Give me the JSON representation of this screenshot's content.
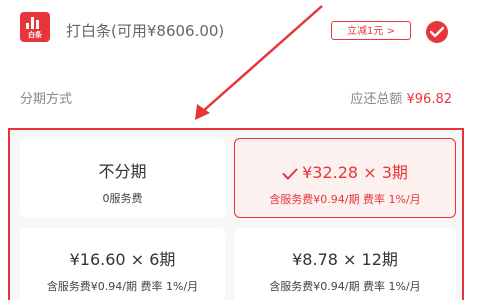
{
  "payment": {
    "logo_icon": "baitiao-logo-icon",
    "logo_text": "白条",
    "title": "打白条(可用¥8606.00)",
    "coupon_label": "立减1元 >",
    "selected_icon": "check-circle-icon"
  },
  "installment": {
    "method_label": "分期方式",
    "total_prefix": "应还总额",
    "total_amount": "¥96.82",
    "plans": [
      {
        "main": "不分期",
        "sub": "0服务费",
        "selected": false
      },
      {
        "main": "¥32.28 × 3期",
        "sub": "含服务费¥0.94/期 费率 1%/月",
        "selected": true
      },
      {
        "main": "¥16.60 × 6期",
        "sub": "含服务费¥0.94/期 费率 1%/月",
        "selected": false
      },
      {
        "main": "¥8.78 × 12期",
        "sub": "含服务费¥0.94/期 费率 1%/月",
        "selected": false
      }
    ]
  },
  "colors": {
    "accent": "#e8353c",
    "selected_bg": "#fdf1f0",
    "text": "#333333",
    "muted": "#888888"
  }
}
